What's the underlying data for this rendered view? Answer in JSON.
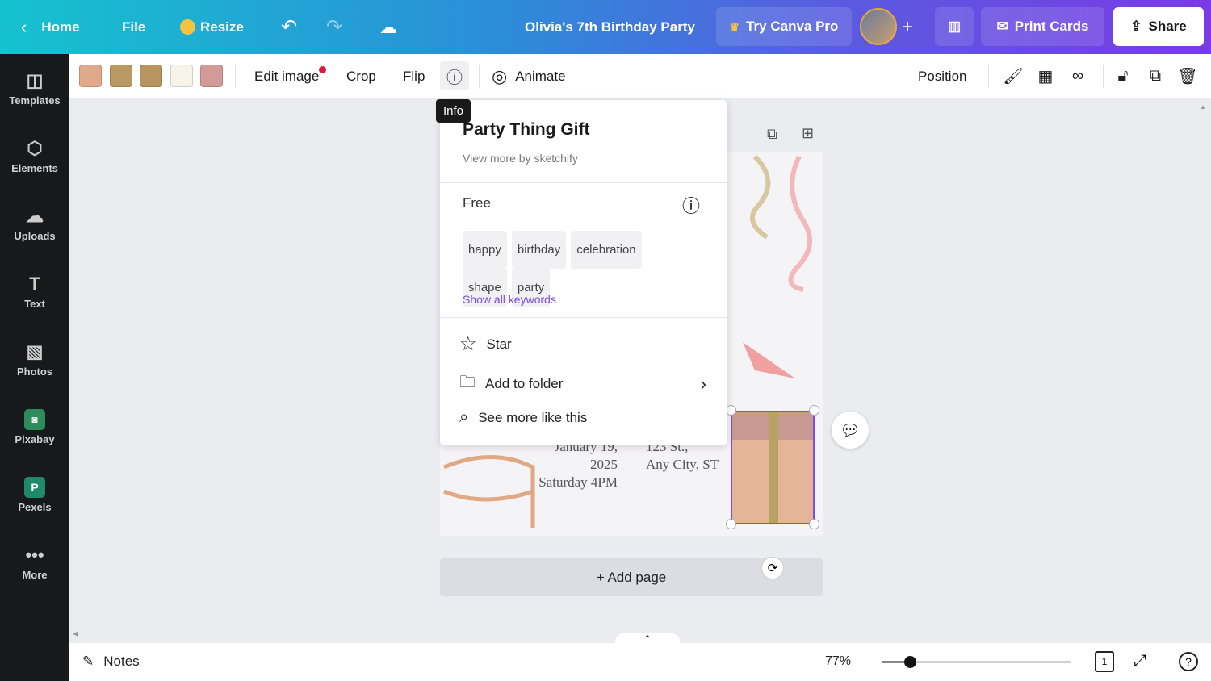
{
  "header": {
    "home": "Home",
    "file": "File",
    "resize": "Resize",
    "title": "Olivia's 7th Birthday Party",
    "try_pro": "Try Canva Pro",
    "print": "Print Cards",
    "share": "Share"
  },
  "sidebar": {
    "items": [
      {
        "label": "Templates",
        "icon": "templates-icon"
      },
      {
        "label": "Elements",
        "icon": "elements-icon"
      },
      {
        "label": "Uploads",
        "icon": "upload-cloud-icon"
      },
      {
        "label": "Text",
        "icon": "text-icon"
      },
      {
        "label": "Photos",
        "icon": "photos-icon"
      },
      {
        "label": "Pixabay",
        "icon": "pixabay-icon"
      },
      {
        "label": "Pexels",
        "icon": "pexels-icon"
      },
      {
        "label": "More",
        "icon": "more-icon"
      }
    ]
  },
  "toolbar": {
    "swatches": [
      "#e0a98a",
      "#b99a63",
      "#b8945e",
      "#f6f3ea",
      "#d39a98"
    ],
    "edit_image": "Edit image",
    "crop": "Crop",
    "flip": "Flip",
    "animate": "Animate",
    "position": "Position"
  },
  "tooltip": "Info",
  "info": {
    "title": "Party Thing Gift",
    "by": "View more by sketchify",
    "license": "Free",
    "tags": [
      "happy",
      "birthday",
      "celebration",
      "shape",
      "party"
    ],
    "show_all": "Show all keywords",
    "menu": [
      "Star",
      "Add to folder",
      "See more like this"
    ]
  },
  "card": {
    "date1": "January 19, 2025",
    "date2": "Saturday 4PM",
    "addr1": "123 St.,",
    "addr2": "Any City, ST"
  },
  "add_page": "+ Add page",
  "bottom": {
    "notes": "Notes",
    "zoom": "77%",
    "zoom_level": 0.15,
    "page": "1"
  }
}
